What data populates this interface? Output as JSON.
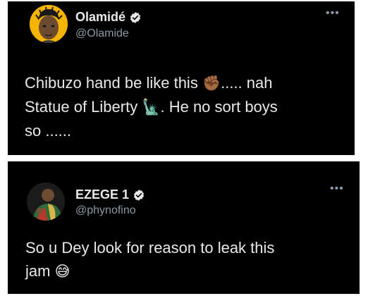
{
  "tweets": [
    {
      "display_name": "Olamidé",
      "handle": "@Olamide",
      "text_lines": [
        {
          "before": "Chibuzo hand be like this ",
          "emoji": "✊🏾",
          "after": "..... nah"
        },
        {
          "before": "Statue of Liberty ",
          "emoji": "🗽",
          "after": ". He no sort boys"
        },
        {
          "before": "so ......",
          "emoji": "",
          "after": ""
        }
      ],
      "avatar_icon": "cartoon-avatar",
      "more_icon": "ellipsis-icon"
    },
    {
      "display_name": "EZEGE 1",
      "handle": "@phynofino",
      "text_lines": [
        {
          "before": "So u Dey look for reason to leak this",
          "emoji": "",
          "after": ""
        },
        {
          "before": "jam ",
          "emoji": "😅",
          "after": ""
        }
      ],
      "avatar_icon": "photo-avatar",
      "more_icon": "ellipsis-icon"
    }
  ],
  "more_label": "•••",
  "colors": {
    "card_bg": "#000000",
    "text_primary": "#e7e9ea",
    "text_secondary": "#8b98a5",
    "verified_blue": "#1d9bf0",
    "avatar_yellow": "#f4b400"
  }
}
